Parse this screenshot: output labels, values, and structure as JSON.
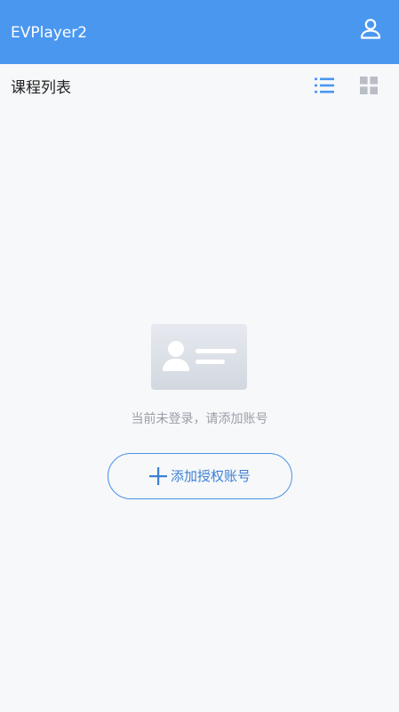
{
  "appbar": {
    "title": "EVPlayer2",
    "account_icon": "person-icon",
    "color": "#4a97f0"
  },
  "subheader": {
    "title": "课程列表",
    "list_view_icon": "list-view-icon",
    "grid_view_icon": "grid-view-icon",
    "active_view": "list"
  },
  "empty_state": {
    "illustration_icon": "id-card-icon",
    "message": "当前未登录，请添加账号",
    "add_button_label": "添加授权账号",
    "add_button_icon": "plus-icon",
    "accent": "#4a92e6"
  }
}
